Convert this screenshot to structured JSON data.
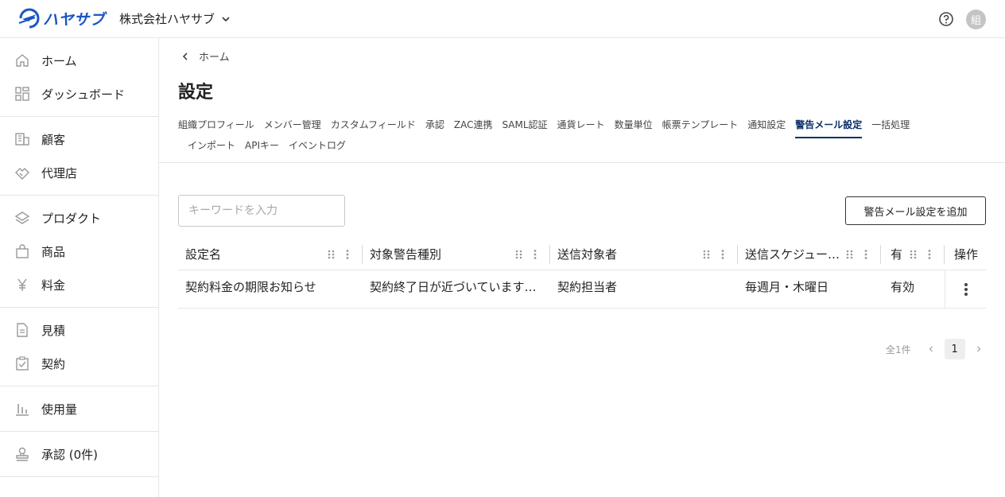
{
  "header": {
    "logo_text": "ハヤサブ",
    "company_name": "株式会社ハヤサブ",
    "avatar_initial": "組"
  },
  "sidebar": {
    "groups": [
      [
        {
          "label": "ホーム",
          "icon": "home-icon"
        },
        {
          "label": "ダッシュボード",
          "icon": "dashboard-icon"
        }
      ],
      [
        {
          "label": "顧客",
          "icon": "building-icon"
        },
        {
          "label": "代理店",
          "icon": "handshake-icon"
        }
      ],
      [
        {
          "label": "プロダクト",
          "icon": "layers-icon"
        },
        {
          "label": "商品",
          "icon": "bag-icon"
        },
        {
          "label": "料金",
          "icon": "yen-icon"
        }
      ],
      [
        {
          "label": "見積",
          "icon": "document-icon"
        },
        {
          "label": "契約",
          "icon": "clipboard-check-icon"
        }
      ],
      [
        {
          "label": "使用量",
          "icon": "bar-chart-icon"
        }
      ],
      [
        {
          "label": "承認 (0件)",
          "icon": "stamp-icon"
        }
      ]
    ]
  },
  "breadcrumb": {
    "label": "ホーム"
  },
  "page": {
    "title": "設定"
  },
  "tabs": {
    "row1": [
      "組織プロフィール",
      "メンバー管理",
      "カスタムフィールド",
      "承認",
      "ZAC連携",
      "SAML認証",
      "通貨レート",
      "数量単位",
      "帳票テンプレート",
      "通知設定",
      "警告メール設定",
      "一括処理"
    ],
    "row2": [
      "インポート",
      "APIキー",
      "イベントログ"
    ],
    "active": "警告メール設定"
  },
  "search": {
    "placeholder": "キーワードを入力",
    "value": ""
  },
  "add_button": {
    "label": "警告メール設定を追加"
  },
  "table": {
    "columns": [
      "設定名",
      "対象警告種別",
      "送信対象者",
      "送信スケジュー…",
      "有",
      "操作"
    ],
    "rows": [
      [
        "契約料金の期限お知らせ",
        "契約終了日が近づいています…",
        "契約担当者",
        "毎週月・木曜日",
        "有効"
      ]
    ]
  },
  "pagination": {
    "total": "全1件",
    "current": "1"
  }
}
